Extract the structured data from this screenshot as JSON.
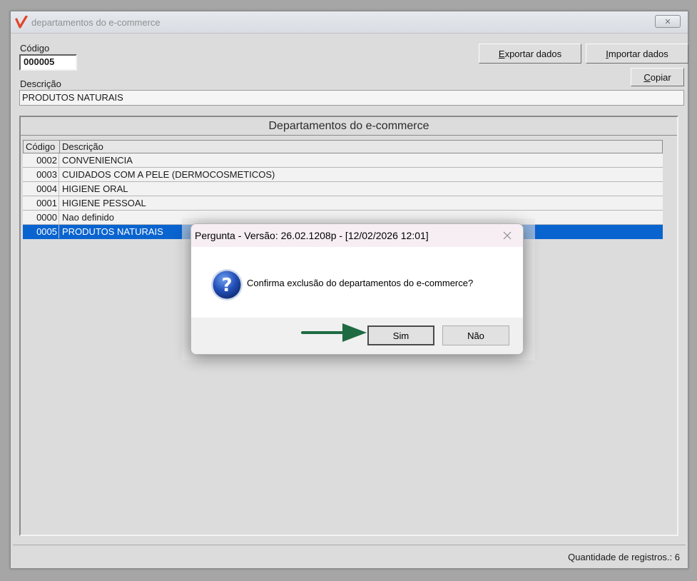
{
  "window": {
    "title": "departamentos do e-commerce",
    "close_symbol": "✕"
  },
  "form": {
    "codigo_label": "Código",
    "codigo_value": "000005",
    "descricao_label": "Descrição",
    "descricao_value": "PRODUTOS NATURAIS"
  },
  "toolbar": {
    "exportar": {
      "first": "E",
      "rest": "xportar dados"
    },
    "importar": {
      "first": "I",
      "rest": "mportar dados"
    },
    "copiar": {
      "first": "C",
      "rest": "opiar"
    }
  },
  "panel": {
    "title": "Departamentos do e-commerce",
    "columns": [
      "Código",
      "Descrição"
    ],
    "rows": [
      {
        "code": "0002",
        "desc": "CONVENIENCIA"
      },
      {
        "code": "0003",
        "desc": "CUIDADOS COM A PELE (DERMOCOSMETICOS)"
      },
      {
        "code": "0004",
        "desc": "HIGIENE ORAL"
      },
      {
        "code": "0001",
        "desc": "HIGIENE PESSOAL"
      },
      {
        "code": "0000",
        "desc": "Nao definido"
      },
      {
        "code": "0005",
        "desc": "PRODUTOS NATURAIS"
      }
    ],
    "selected_row_index": 5
  },
  "status": {
    "records_text": "Quantidade de registros.: 6"
  },
  "dialog": {
    "title": "Pergunta - Versão: 26.02.1208p - [12/02/2026 12:01]",
    "message": "Confirma exclusão do departamentos do e-commerce?",
    "yes_label": "Sim",
    "no_label": "Não",
    "icon": "question-icon"
  },
  "colors": {
    "selection": "#0a64d0",
    "arrow": "#1e6b42",
    "logo": "#e2452a"
  }
}
